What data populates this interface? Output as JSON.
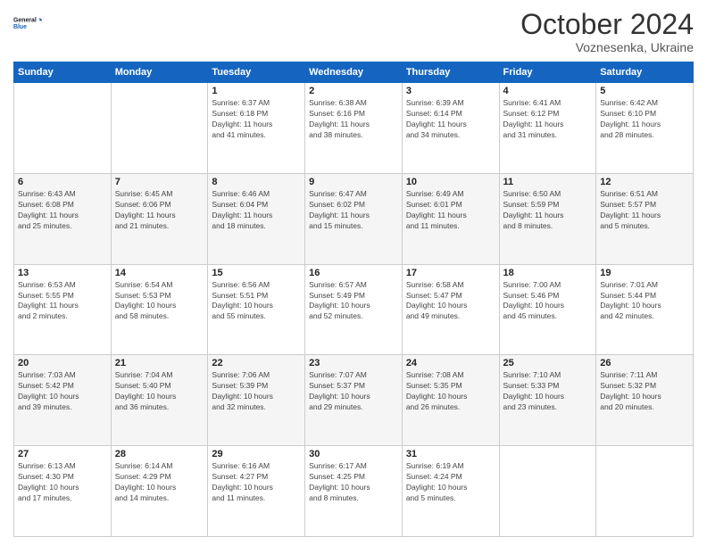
{
  "header": {
    "logo": {
      "line1": "General",
      "line2": "Blue"
    },
    "title": "October 2024",
    "subtitle": "Voznesenka, Ukraine"
  },
  "days_of_week": [
    "Sunday",
    "Monday",
    "Tuesday",
    "Wednesday",
    "Thursday",
    "Friday",
    "Saturday"
  ],
  "weeks": [
    [
      {
        "day": "",
        "info": ""
      },
      {
        "day": "",
        "info": ""
      },
      {
        "day": "1",
        "info": "Sunrise: 6:37 AM\nSunset: 6:18 PM\nDaylight: 11 hours\nand 41 minutes."
      },
      {
        "day": "2",
        "info": "Sunrise: 6:38 AM\nSunset: 6:16 PM\nDaylight: 11 hours\nand 38 minutes."
      },
      {
        "day": "3",
        "info": "Sunrise: 6:39 AM\nSunset: 6:14 PM\nDaylight: 11 hours\nand 34 minutes."
      },
      {
        "day": "4",
        "info": "Sunrise: 6:41 AM\nSunset: 6:12 PM\nDaylight: 11 hours\nand 31 minutes."
      },
      {
        "day": "5",
        "info": "Sunrise: 6:42 AM\nSunset: 6:10 PM\nDaylight: 11 hours\nand 28 minutes."
      }
    ],
    [
      {
        "day": "6",
        "info": "Sunrise: 6:43 AM\nSunset: 6:08 PM\nDaylight: 11 hours\nand 25 minutes."
      },
      {
        "day": "7",
        "info": "Sunrise: 6:45 AM\nSunset: 6:06 PM\nDaylight: 11 hours\nand 21 minutes."
      },
      {
        "day": "8",
        "info": "Sunrise: 6:46 AM\nSunset: 6:04 PM\nDaylight: 11 hours\nand 18 minutes."
      },
      {
        "day": "9",
        "info": "Sunrise: 6:47 AM\nSunset: 6:02 PM\nDaylight: 11 hours\nand 15 minutes."
      },
      {
        "day": "10",
        "info": "Sunrise: 6:49 AM\nSunset: 6:01 PM\nDaylight: 11 hours\nand 11 minutes."
      },
      {
        "day": "11",
        "info": "Sunrise: 6:50 AM\nSunset: 5:59 PM\nDaylight: 11 hours\nand 8 minutes."
      },
      {
        "day": "12",
        "info": "Sunrise: 6:51 AM\nSunset: 5:57 PM\nDaylight: 11 hours\nand 5 minutes."
      }
    ],
    [
      {
        "day": "13",
        "info": "Sunrise: 6:53 AM\nSunset: 5:55 PM\nDaylight: 11 hours\nand 2 minutes."
      },
      {
        "day": "14",
        "info": "Sunrise: 6:54 AM\nSunset: 5:53 PM\nDaylight: 10 hours\nand 58 minutes."
      },
      {
        "day": "15",
        "info": "Sunrise: 6:56 AM\nSunset: 5:51 PM\nDaylight: 10 hours\nand 55 minutes."
      },
      {
        "day": "16",
        "info": "Sunrise: 6:57 AM\nSunset: 5:49 PM\nDaylight: 10 hours\nand 52 minutes."
      },
      {
        "day": "17",
        "info": "Sunrise: 6:58 AM\nSunset: 5:47 PM\nDaylight: 10 hours\nand 49 minutes."
      },
      {
        "day": "18",
        "info": "Sunrise: 7:00 AM\nSunset: 5:46 PM\nDaylight: 10 hours\nand 45 minutes."
      },
      {
        "day": "19",
        "info": "Sunrise: 7:01 AM\nSunset: 5:44 PM\nDaylight: 10 hours\nand 42 minutes."
      }
    ],
    [
      {
        "day": "20",
        "info": "Sunrise: 7:03 AM\nSunset: 5:42 PM\nDaylight: 10 hours\nand 39 minutes."
      },
      {
        "day": "21",
        "info": "Sunrise: 7:04 AM\nSunset: 5:40 PM\nDaylight: 10 hours\nand 36 minutes."
      },
      {
        "day": "22",
        "info": "Sunrise: 7:06 AM\nSunset: 5:39 PM\nDaylight: 10 hours\nand 32 minutes."
      },
      {
        "day": "23",
        "info": "Sunrise: 7:07 AM\nSunset: 5:37 PM\nDaylight: 10 hours\nand 29 minutes."
      },
      {
        "day": "24",
        "info": "Sunrise: 7:08 AM\nSunset: 5:35 PM\nDaylight: 10 hours\nand 26 minutes."
      },
      {
        "day": "25",
        "info": "Sunrise: 7:10 AM\nSunset: 5:33 PM\nDaylight: 10 hours\nand 23 minutes."
      },
      {
        "day": "26",
        "info": "Sunrise: 7:11 AM\nSunset: 5:32 PM\nDaylight: 10 hours\nand 20 minutes."
      }
    ],
    [
      {
        "day": "27",
        "info": "Sunrise: 6:13 AM\nSunset: 4:30 PM\nDaylight: 10 hours\nand 17 minutes."
      },
      {
        "day": "28",
        "info": "Sunrise: 6:14 AM\nSunset: 4:29 PM\nDaylight: 10 hours\nand 14 minutes."
      },
      {
        "day": "29",
        "info": "Sunrise: 6:16 AM\nSunset: 4:27 PM\nDaylight: 10 hours\nand 11 minutes."
      },
      {
        "day": "30",
        "info": "Sunrise: 6:17 AM\nSunset: 4:25 PM\nDaylight: 10 hours\nand 8 minutes."
      },
      {
        "day": "31",
        "info": "Sunrise: 6:19 AM\nSunset: 4:24 PM\nDaylight: 10 hours\nand 5 minutes."
      },
      {
        "day": "",
        "info": ""
      },
      {
        "day": "",
        "info": ""
      }
    ]
  ]
}
